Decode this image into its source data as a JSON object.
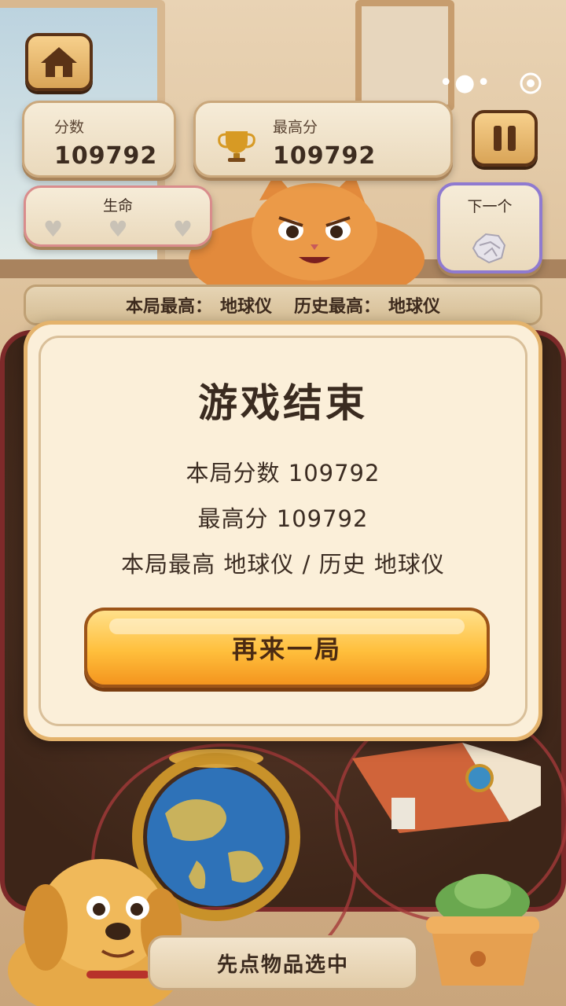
{
  "score": {
    "label": "分数",
    "value": "109792"
  },
  "best": {
    "label": "最高分",
    "value": "109792"
  },
  "lives": {
    "label": "生命",
    "count": 3
  },
  "next": {
    "label": "下一个"
  },
  "record": {
    "round_label": "本局最高：",
    "round_value": "地球仪",
    "history_label": "历史最高：",
    "history_value": "地球仪"
  },
  "modal": {
    "title": "游戏结束",
    "score_line": "本局分数  109792",
    "best_line": "最高分  109792",
    "record_line": "本局最高  地球仪 / 历史  地球仪",
    "retry_label": "再来一局"
  },
  "hint": "先点物品选中",
  "colors": {
    "accent": "#ffbf3c",
    "frame": "#5a3216",
    "board_border": "#7e2a2a"
  }
}
